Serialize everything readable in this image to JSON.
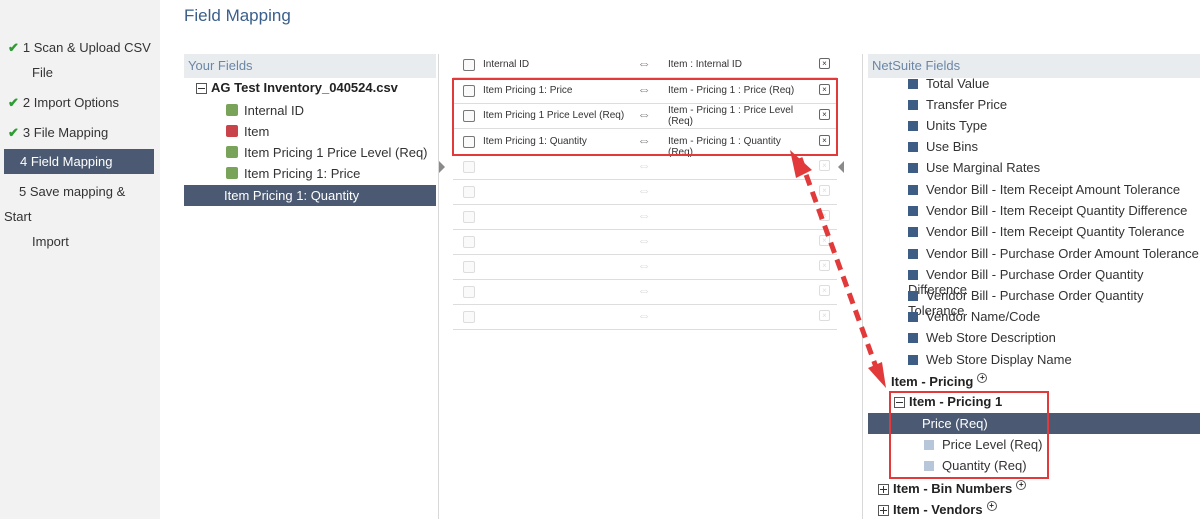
{
  "page_title": "Field Mapping",
  "steps": [
    {
      "label": "1 Scan & Upload CSV",
      "label2": "File",
      "done": true
    },
    {
      "label": "2 Import Options",
      "done": true
    },
    {
      "label": "3 File Mapping",
      "done": true
    },
    {
      "label": "4 Field Mapping",
      "active": true
    },
    {
      "label": "5 Save mapping & Start",
      "label2": "Import"
    }
  ],
  "check_glyph": "✔",
  "your_fields": {
    "header": "Your Fields",
    "file": "AG Test Inventory_040524.csv",
    "items": [
      "Internal ID",
      "Item",
      "Item Pricing 1 Price Level (Req)",
      "Item Pricing 1: Price"
    ],
    "selected": "Item Pricing 1: Quantity"
  },
  "mappings": [
    {
      "src": "Internal ID",
      "dst": "Item : Internal ID"
    },
    {
      "src": "Item Pricing 1: Price",
      "dst": "Item - Pricing 1 : Price (Req)"
    },
    {
      "src": "Item Pricing 1 Price Level (Req)",
      "dst": "Item - Pricing 1 : Price Level (Req)"
    },
    {
      "src": "Item Pricing 1: Quantity",
      "dst": "Item - Pricing 1 : Quantity (Req)"
    }
  ],
  "arrow_glyph": "⇔",
  "delete_glyph": "×",
  "netsuite_fields": {
    "header": "NetSuite Fields",
    "items": [
      "Total Value",
      "Transfer Price",
      "Units Type",
      "Use Bins",
      "Use Marginal Rates",
      "Vendor Bill - Item Receipt Amount Tolerance",
      "Vendor Bill - Item Receipt Quantity Difference",
      "Vendor Bill - Item Receipt Quantity Tolerance",
      "Vendor Bill - Purchase Order Amount Tolerance",
      "Vendor Bill - Purchase Order Quantity Difference",
      "Vendor Bill - Purchase Order Quantity Tolerance",
      "Vendor Name/Code",
      "Web Store Description",
      "Web Store Display Name"
    ],
    "group_pricing": "Item - Pricing",
    "group_pricing1": "Item - Pricing 1",
    "selected": "Price (Req)",
    "sub_items": [
      "Price Level (Req)",
      "Quantity (Req)"
    ],
    "group_bin": "Item - Bin Numbers",
    "group_vendors": "Item - Vendors"
  },
  "colors": {
    "accent": "#4b5a72",
    "highlight": "#e23a3a",
    "check": "#2e9b34"
  }
}
